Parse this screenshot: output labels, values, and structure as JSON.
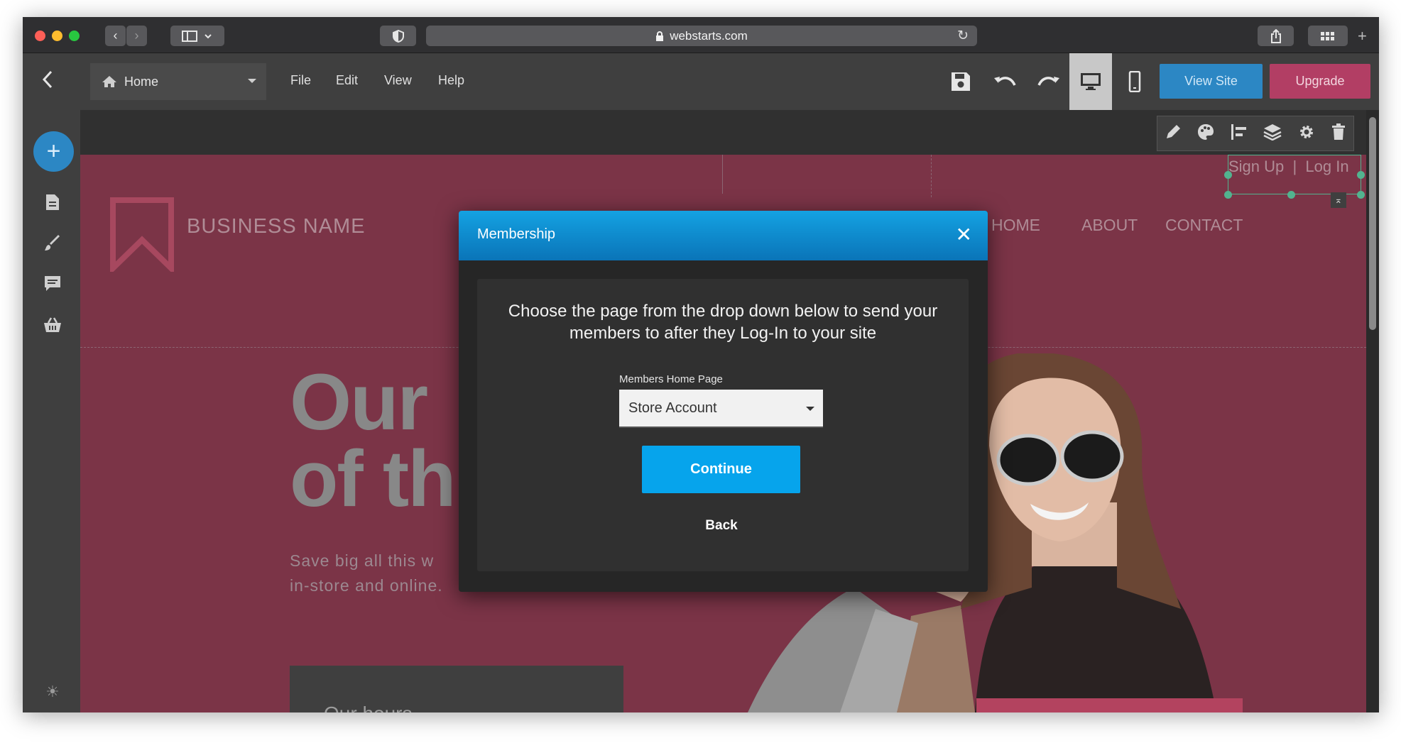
{
  "browser": {
    "url": "webstarts.com"
  },
  "toolbar": {
    "page_select": "Home",
    "menus": [
      "File",
      "Edit",
      "View",
      "Help"
    ],
    "view_site": "View Site",
    "upgrade": "Upgrade"
  },
  "site": {
    "business_name": "BUSINESS NAME",
    "nav": [
      "HOME",
      "ABOUT",
      "CONTACT"
    ],
    "auth": "Sign Up  |  Log In",
    "hero_title_line1": "Our",
    "hero_title_line2": "of th",
    "hero_sub_line1": "Save big all this w",
    "hero_sub_line2": "in-store and online.",
    "hours": "Our hours"
  },
  "modal": {
    "title": "Membership",
    "close": "✕",
    "message": "Choose the page from the drop down below to send your members to after they Log-In to your site",
    "field_label": "Members Home Page",
    "select_value": "Store Account",
    "continue": "Continue",
    "back": "Back"
  },
  "colors": {
    "brand_blue": "#2c87c4",
    "upgrade_pink": "#b23e64",
    "modal_blue": "#06a4ec",
    "site_bg": "#7b3447"
  }
}
